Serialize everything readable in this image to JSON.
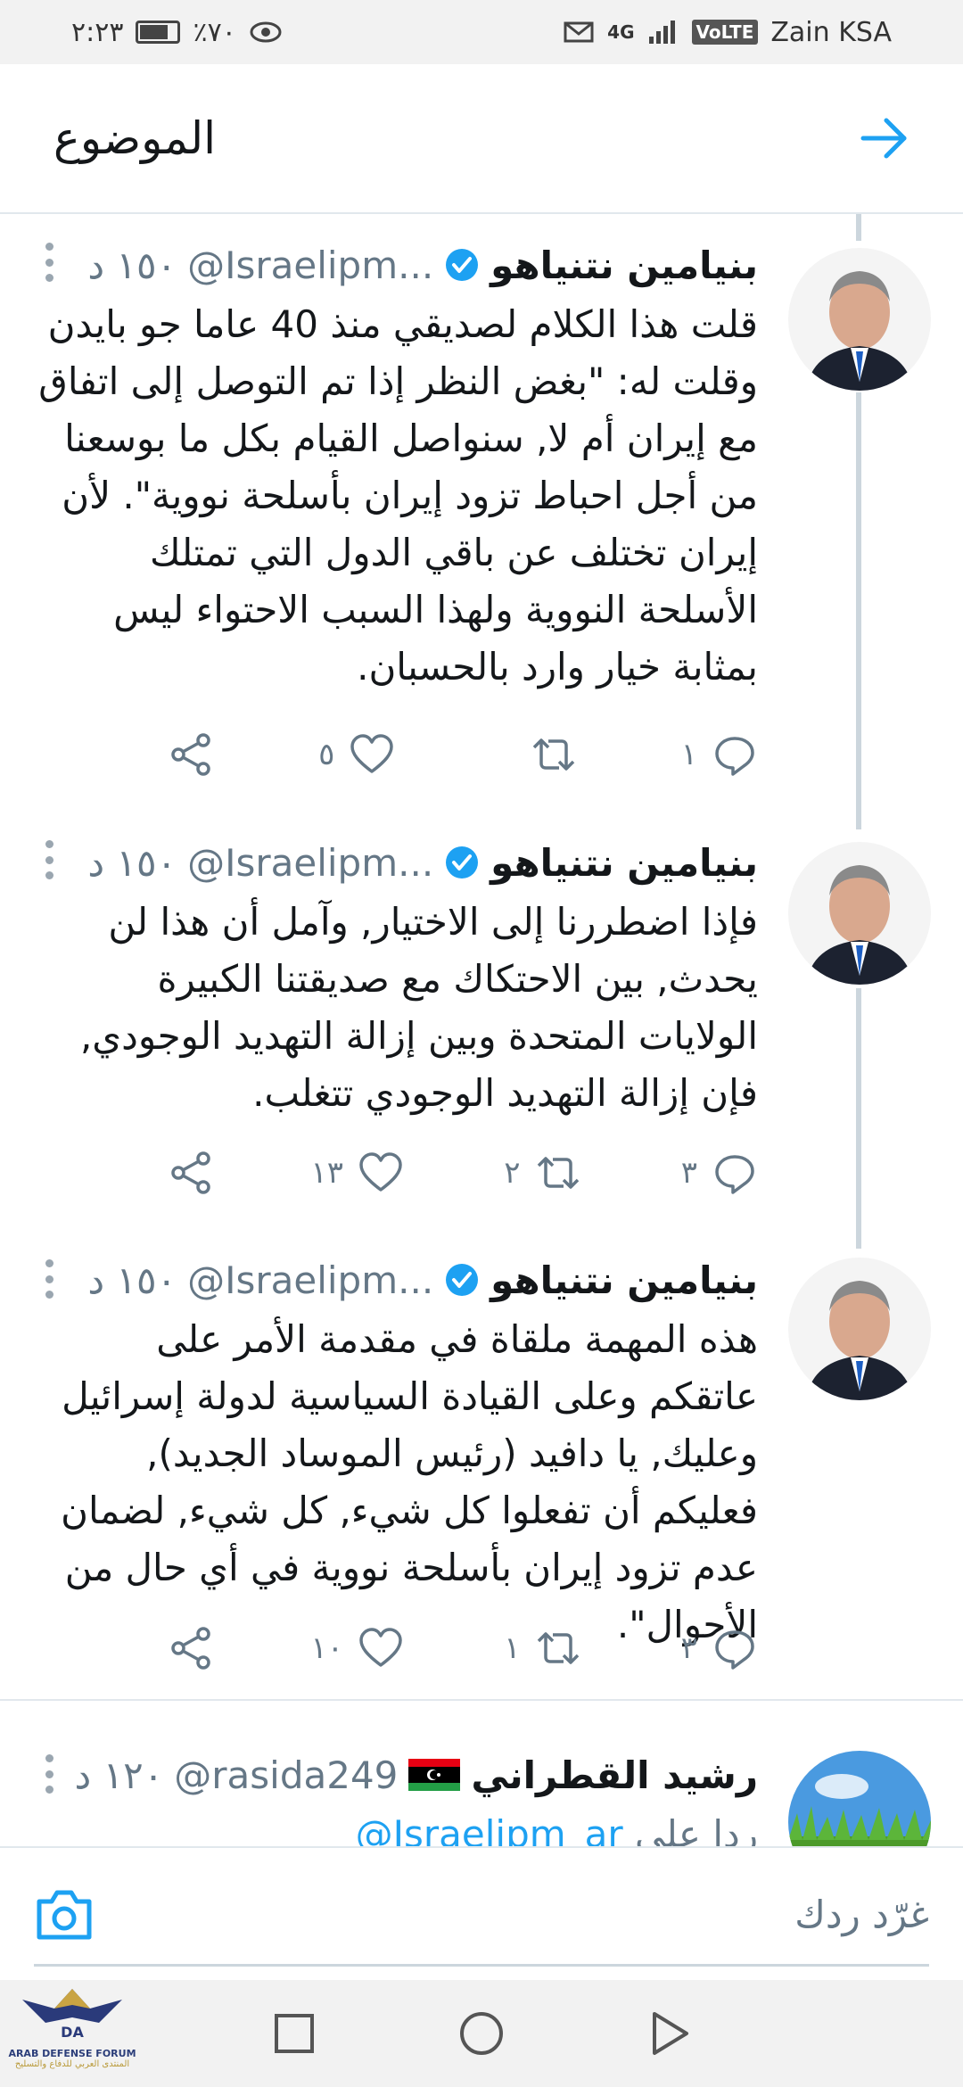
{
  "status_bar": {
    "time": "٢:٢٣",
    "battery": "٪٧٠",
    "carrier": "Zain KSA",
    "signal": "4G",
    "volte": "VoLTE"
  },
  "header": {
    "title": "الموضوع"
  },
  "tweets": [
    {
      "name": "بنيامين نتنياهو",
      "handle": "@Israelipm...",
      "time": "١٥٠ د",
      "text": "قلت هذا الكلام لصديقي منذ 40 عاما جو بايدن وقلت له: \"بغض النظر إذا تم التوصل إلى اتفاق مع إيران أم لا, سنواصل القيام بكل ما بوسعنا من أجل احباط تزود إيران بأسلحة نووية\". لأن إيران تختلف عن باقي الدول التي تمتلك الأسلحة النووية ولهذا السبب الاحتواء ليس بمثابة خيار وارد بالحسبان.",
      "replies": "١",
      "retweets": "",
      "likes": "٥"
    },
    {
      "name": "بنيامين نتنياهو",
      "handle": "@Israelipm...",
      "time": "١٥٠ د",
      "text": "فإذا اضطررنا إلى الاختيار, وآمل أن هذا لن يحدث, بين الاحتكاك مع صديقتنا الكبيرة الولايات المتحدة وبين إزالة التهديد الوجودي, فإن إزالة التهديد الوجودي تتغلب.",
      "replies": "٣",
      "retweets": "٢",
      "likes": "١٣"
    },
    {
      "name": "بنيامين نتنياهو",
      "handle": "@Israelipm...",
      "time": "١٥٠ د",
      "text": "هذه المهمة ملقاة في مقدمة الأمر على عاتقكم وعلى القيادة السياسية لدولة إسرائيل وعليك, يا دافيد (رئيس الموساد الجديد), فعليكم أن تفعلوا كل شيء, كل شيء, لضمان عدم تزود إيران بأسلحة نووية في أي حال من الأحوال\".",
      "replies": "٣",
      "retweets": "١",
      "likes": "١٠"
    }
  ],
  "reply_tweet": {
    "name": "رشيد القطراني",
    "handle": "@rasida249",
    "time": "١٢٠ د",
    "reply_to_prefix": "ردا على",
    "reply_to_handle": "@Israelipm_ar"
  },
  "composer": {
    "placeholder": "غرّد ردك"
  },
  "watermark": {
    "logo": "DA",
    "title": "ARAB DEFENSE FORUM",
    "subtitle": "المنتدى العربي للدفاع والتسليح"
  },
  "colors": {
    "accent": "#1da1f2",
    "secondary_text": "#657786",
    "divider": "#e1e8ed"
  }
}
